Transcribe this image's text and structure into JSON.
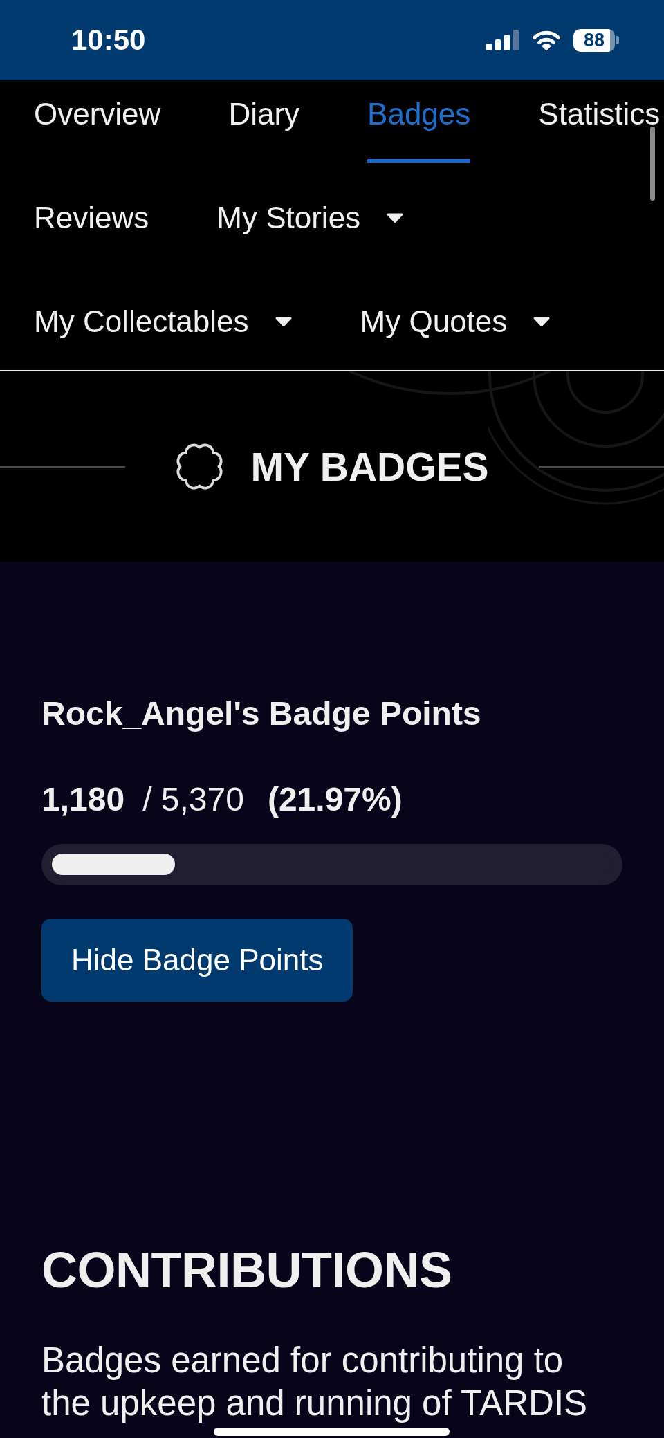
{
  "status_bar": {
    "time": "10:50",
    "battery": "88"
  },
  "nav": {
    "rows": [
      {
        "items": [
          {
            "label": "Overview",
            "kind": "tab",
            "selected": false
          },
          {
            "label": "Diary",
            "kind": "tab",
            "selected": false
          },
          {
            "label": "Badges",
            "kind": "tab",
            "selected": true
          },
          {
            "label": "Statistics",
            "kind": "tab",
            "selected": false
          }
        ]
      },
      {
        "items": [
          {
            "label": "Reviews",
            "kind": "tab",
            "selected": false
          },
          {
            "label": "My Stories",
            "kind": "dropdown",
            "selected": false
          }
        ]
      },
      {
        "items": [
          {
            "label": "My Collectables",
            "kind": "dropdown",
            "selected": false
          },
          {
            "label": "My Quotes",
            "kind": "dropdown",
            "selected": false
          }
        ]
      }
    ]
  },
  "header": {
    "title": "MY BADGES"
  },
  "badge_points": {
    "title": "Rock_Angel's Badge Points",
    "earned": "1,180",
    "total": "/ 5,370",
    "percent": "(21.97%)",
    "level": 0.2197,
    "button": "Hide Badge Points"
  },
  "contributions": {
    "title": "CONTRIBUTIONS",
    "description": "Badges earned for contributing to the upkeep and running of TARDIS"
  }
}
